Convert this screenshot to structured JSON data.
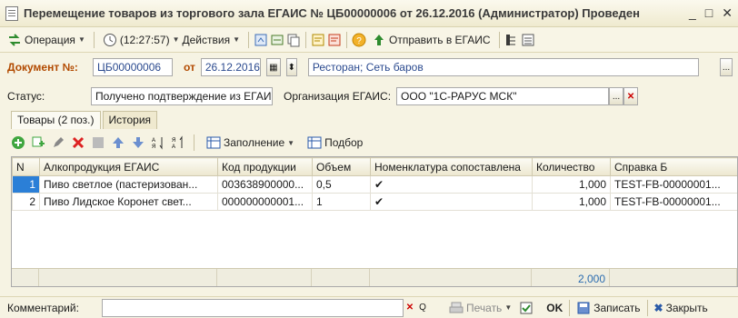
{
  "window": {
    "title": "Перемещение товаров из торгового зала ЕГАИС № ЦБ00000006 от 26.12.2016 (Администратор) Проведен",
    "minimize": "_",
    "maximize": "□",
    "close": "✕"
  },
  "toolbar": {
    "operation": "Операция",
    "time": "(12:27:57)",
    "actions": "Действия",
    "send": "Отправить в ЕГАИС"
  },
  "header": {
    "doc_label": "Документ №:",
    "doc_number": "ЦБ00000006",
    "date_label": "от",
    "date": "26.12.2016",
    "place": "Ресторан; Сеть баров",
    "more": "..."
  },
  "status": {
    "label": "Статус:",
    "value": "Получено подтверждение из ЕГАИС",
    "org_label": "Организация ЕГАИС:",
    "org_value": "ООО \"1С-РАРУС МСК\"",
    "org_more": "...",
    "org_clear": "✕"
  },
  "tabs": [
    {
      "label": "Товары (2 поз.)"
    },
    {
      "label": "История"
    }
  ],
  "grid_toolbar": {
    "fill": "Заполнение",
    "pick": "Подбор"
  },
  "grid": {
    "columns": [
      "N",
      "Алкопродукция ЕГАИС",
      "Код продукции",
      "Объем",
      "Номенклатура сопоставлена",
      "Количество",
      "Справка Б"
    ],
    "rows": [
      {
        "n": "1",
        "product": "Пиво светлое (пастеризован...",
        "code": "003638900000...",
        "volume": "0,5",
        "matched": "✔",
        "qty": "1,000",
        "ref": "TEST-FB-00000001..."
      },
      {
        "n": "2",
        "product": "Пиво Лидское Коронет свет...",
        "code": "000000000001...",
        "volume": "1",
        "matched": "✔",
        "qty": "1,000",
        "ref": "TEST-FB-00000001..."
      }
    ],
    "total_qty": "2,000"
  },
  "bottom": {
    "comment_label": "Комментарий:",
    "comment_value": "",
    "clear": "✕",
    "search": "Q",
    "print": "Печать",
    "ok": "OK",
    "save": "Записать",
    "close": "Закрыть"
  }
}
